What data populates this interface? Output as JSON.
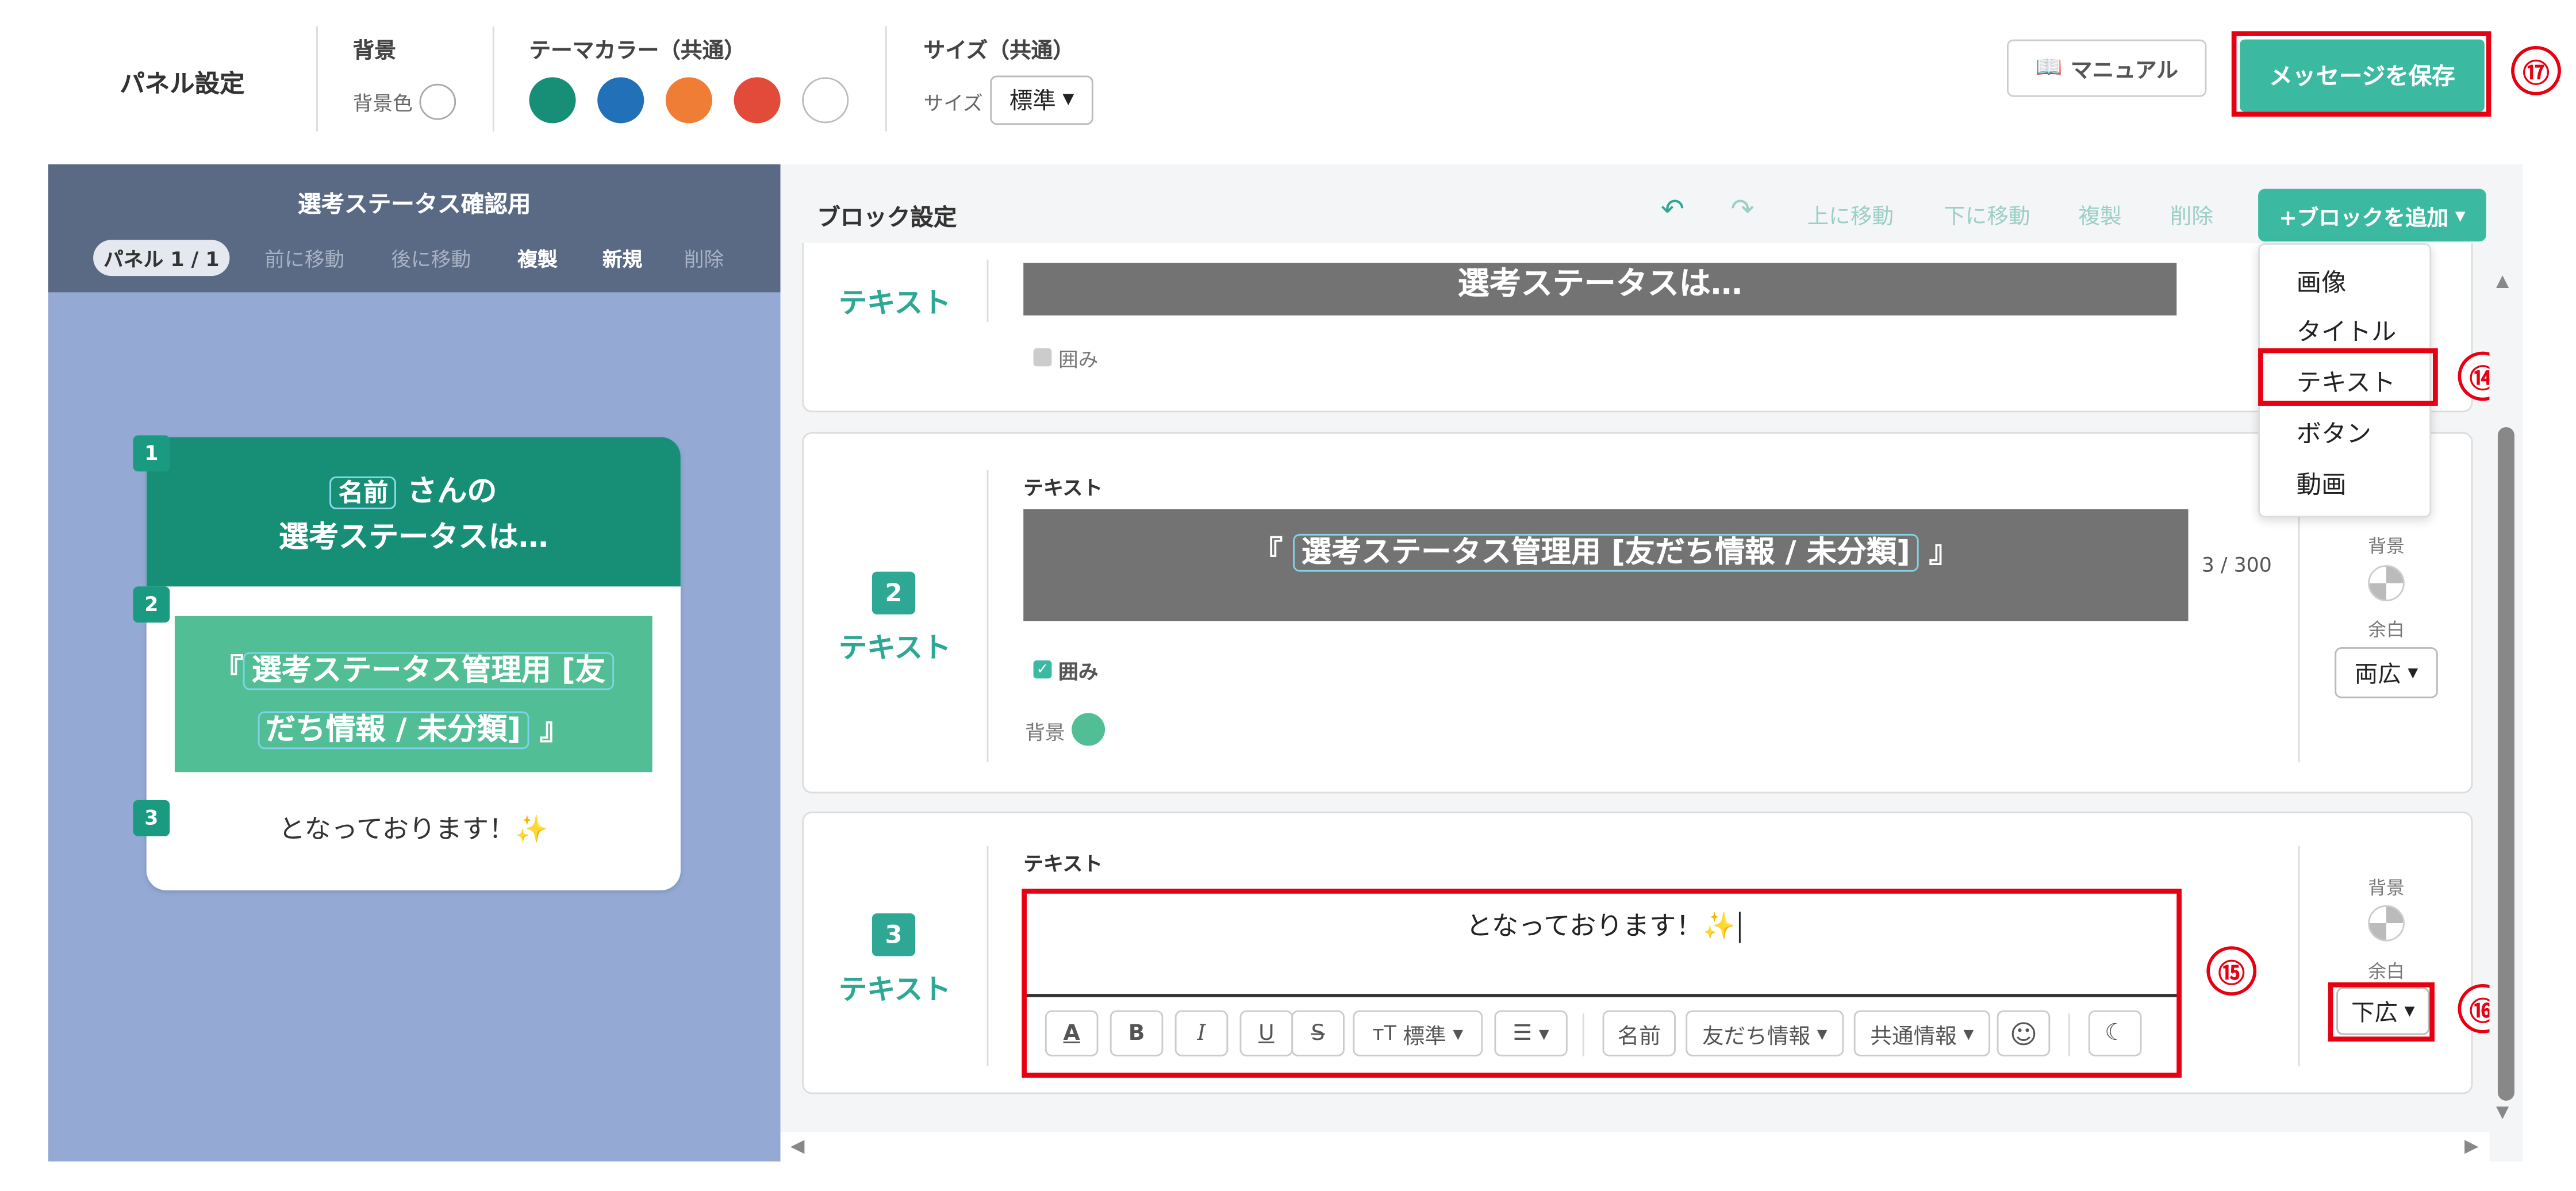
{
  "header": {
    "panel_settings": "パネル設定",
    "bg_heading": "背景",
    "bg_color_label": "背景色",
    "theme_heading": "テーマカラー（共通）",
    "theme_colors": [
      "#168f76",
      "#2271b8",
      "#ef7d35",
      "#e24b3a",
      "#ffffff"
    ],
    "size_heading": "サイズ（共通）",
    "size_label": "サイズ",
    "size_value": "標準",
    "manual_label": "マニュアル",
    "save_label": "メッセージを保存"
  },
  "left_panel": {
    "title": "選考ステータス確認用",
    "panel_counter": "パネル 1 / 1",
    "prev": "前に移動",
    "next": "後に移動",
    "duplicate": "複製",
    "new": "新規",
    "delete": "削除",
    "preview": {
      "b1_num": "1",
      "b1_tag": "名前",
      "b1_suffix": "さんの",
      "b1_line2": "選考ステータスは…",
      "b2_num": "2",
      "b2_open": "『",
      "b2_tag_line1": "選考ステータス管理用 [友",
      "b2_tag_line2": "だち情報 / 未分類]",
      "b2_close": "』",
      "b3_num": "3",
      "b3_text": "となっております！✨"
    }
  },
  "block_settings": {
    "title": "ブロック設定",
    "toolbar": {
      "undo": "↶",
      "redo": "↷",
      "move_up": "上に移動",
      "move_down": "下に移動",
      "duplicate": "複製",
      "delete": "削除",
      "add_block": "+ブロックを追加"
    },
    "add_menu": [
      "画像",
      "タイトル",
      "テキスト",
      "ボタン",
      "動画"
    ],
    "blocks": [
      {
        "type": "テキスト",
        "content": "選考ステータスは…",
        "frame": "囲み"
      },
      {
        "num": "2",
        "type": "テキスト",
        "label": "テキスト",
        "open": "『",
        "tag": "選考ステータス管理用 [友だち情報 / 未分類]",
        "close": "』",
        "count": "3 / 300",
        "frame": "囲み",
        "bg_label": "背景",
        "side_bg": "背景",
        "side_margin": "余白",
        "margin_value": "両広"
      },
      {
        "num": "3",
        "type": "テキスト",
        "label": "テキスト",
        "content": "となっております！✨",
        "side_bg": "背景",
        "side_margin": "余白",
        "margin_value": "下広"
      }
    ],
    "editor_toolbar": {
      "font_color": "A",
      "bold": "B",
      "italic": "I",
      "underline": "U",
      "strike": "S",
      "size_label": "標準",
      "name": "名前",
      "friend_info": "友だち情報",
      "common_info": "共通情報"
    }
  },
  "annotations": {
    "a14": "⑭",
    "a15": "⑮",
    "a16": "⑯",
    "a17": "⑰"
  },
  "colors": {
    "accent": "#2ea894",
    "header_dark": "#5a6a85",
    "panel_bg": "#94aad5",
    "highlight": "#e60012"
  }
}
